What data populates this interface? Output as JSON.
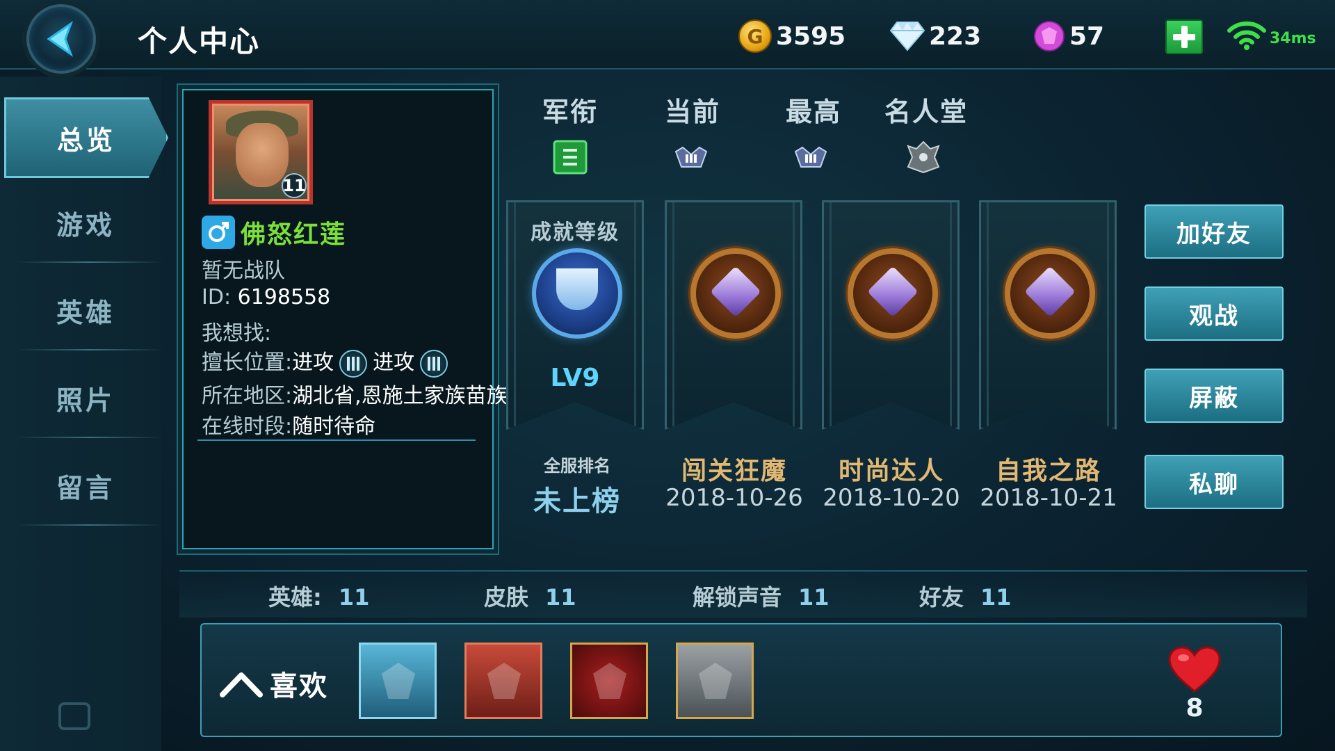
{
  "header": {
    "title": "个人中心",
    "gold": "3595",
    "diamond": "223",
    "gem": "57",
    "gold_glyph": "G",
    "ping": "34ms"
  },
  "sidebar": {
    "items": [
      {
        "label": "总览",
        "active": true
      },
      {
        "label": "游戏",
        "active": false
      },
      {
        "label": "英雄",
        "active": false
      },
      {
        "label": "照片",
        "active": false
      },
      {
        "label": "留言",
        "active": false
      }
    ]
  },
  "profile": {
    "level": "11",
    "name": "佛怒红莲",
    "team": "暂无战队",
    "id_label": "ID:",
    "id_value": "6198558",
    "looking_for_label": "我想找:",
    "position_label": "擅长位置:",
    "position_1": "进攻",
    "position_2": "进攻",
    "region_label": "所在地区:",
    "region_value": "湖北省,恩施土家族苗族",
    "online_label": "在线时段:",
    "online_value": "随时待命"
  },
  "ranks": {
    "labels": [
      "军衔",
      "当前",
      "最高",
      "名人堂"
    ]
  },
  "achievements": {
    "level_card": {
      "title": "成就等级",
      "level": "LV9"
    },
    "rank_caption": "全服排名",
    "rank_value": "未上榜",
    "cards": [
      {
        "name": "闯关狂魔",
        "date": "2018-10-26"
      },
      {
        "name": "时尚达人",
        "date": "2018-10-20"
      },
      {
        "name": "自我之路",
        "date": "2018-10-21"
      }
    ]
  },
  "actions": {
    "add_friend": "加好友",
    "spectate": "观战",
    "block": "屏蔽",
    "private_chat": "私聊"
  },
  "stats": {
    "heroes_label": "英雄:",
    "heroes": "11",
    "skins_label": "皮肤",
    "skins": "11",
    "voices_label": "解锁声音",
    "voices": "11",
    "friends_label": "好友",
    "friends": "11"
  },
  "likes": {
    "label": "喜欢",
    "count": "8"
  }
}
